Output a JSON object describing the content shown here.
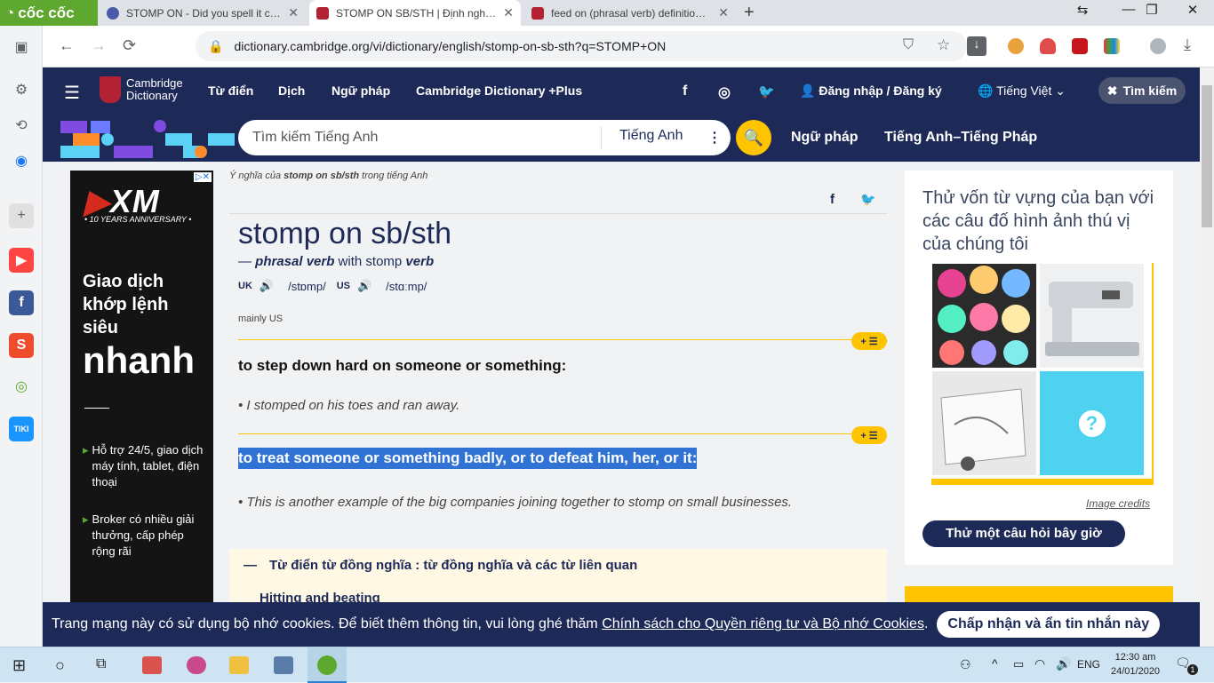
{
  "browser": {
    "brand": "cốc cốc",
    "tabs": [
      {
        "title": "STOMP ON - Did you spell it corre",
        "active": false,
        "color": "#4a5aa8"
      },
      {
        "title": "STOMP ON SB/STH | Định nghĩa tr",
        "active": true,
        "color": "#b22234"
      },
      {
        "title": "feed on (phrasal verb) definition ar",
        "active": false,
        "color": "#b22234"
      }
    ],
    "url": "dictionary.cambridge.org/vi/dictionary/english/stomp-on-sb-sth?q=STOMP+ON"
  },
  "site": {
    "logo_line1": "Cambridge",
    "logo_line2": "Dictionary",
    "nav": [
      "Từ điển",
      "Dịch",
      "Ngữ pháp",
      "Cambridge Dictionary +Plus"
    ],
    "login": "Đăng nhập / Đăng ký",
    "language": "Tiếng Việt",
    "search_toggle": "Tìm kiếm",
    "search_placeholder": "Tìm kiếm Tiếng Anh",
    "search_dict": "Tiếng Anh",
    "link_grammar": "Ngữ pháp",
    "link_enfr": "Tiếng Anh–Tiếng Pháp"
  },
  "ad": {
    "brand": "XM",
    "anniversary": "• 10 YEARS ANNIVERSARY •",
    "headline1": "Giao dịch",
    "headline2": "khớp lệnh",
    "headline3": "siêu",
    "headline_big": "nhanh",
    "bullet1": "Hỗ trợ 24/5, giao dịch máy tính, tablet, điện thoại",
    "bullet2": "Broker có nhiều giải thưởng, cấp phép rộng rãi"
  },
  "entry": {
    "breadcrumb_pre": "Ý nghĩa của ",
    "breadcrumb_word": "stomp on sb/sth",
    "breadcrumb_post": " trong tiếng Anh",
    "headword": "stomp on sb/sth",
    "pos_dash": "— ",
    "pos": "phrasal verb",
    "pos_with": " with stomp ",
    "pos_verb": "verb",
    "uk_label": "UK",
    "uk_ipa": "/stɒmp/",
    "us_label": "US",
    "us_ipa": "/stɑːmp/",
    "region": "mainly US",
    "plus_label": "+ ☰",
    "def1": "to step down hard on someone or something:",
    "ex1": "I stomped on his toes and ran away.",
    "def2": "to treat someone or something badly, or to defeat him, her, or it:",
    "ex2": "This is another example of the big companies joining together to stomp on small businesses.",
    "thesaurus_title": "Từ điển từ đồng nghĩa : từ đồng nghĩa và các từ liên quan",
    "thesaurus_item": "Hitting and beating"
  },
  "quiz": {
    "text": "Thử vốn từ vựng của bạn với các câu đố hình ảnh thú vị của chúng tôi",
    "credits": "Image credits",
    "button": "Thử một câu hỏi bây giờ"
  },
  "cookie": {
    "text": "Trang mạng này có sử dụng bộ nhớ cookies. Để biết thêm thông tin, vui lòng ghé thăm",
    "link": "Chính sách cho Quyền riêng tư và Bộ nhớ Cookies",
    "dot": ".",
    "button": "Chấp nhận và ẩn tin nhắn này"
  },
  "taskbar": {
    "lang": "ENG",
    "time": "12:30 am",
    "date": "24/01/2020",
    "notif": "1"
  }
}
